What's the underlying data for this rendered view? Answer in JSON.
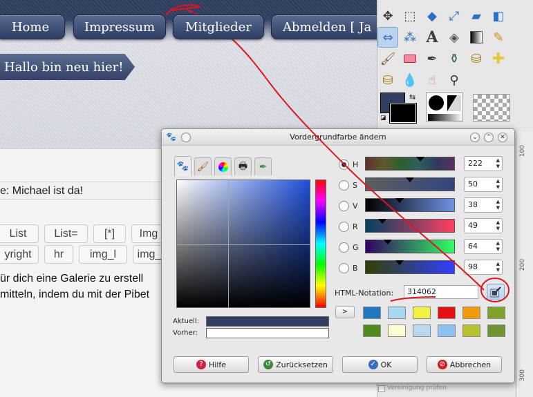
{
  "website": {
    "nav": {
      "home": "Home",
      "impressum": "Impressum",
      "mitglieder": "Mitglieder",
      "abmelden": "Abmelden [ Ja"
    },
    "post_title": "Hallo bin neu hier!",
    "reply_subject": "e: Michael ist da!",
    "bbcode_row1": [
      "List",
      "List=",
      "[*]",
      "Img"
    ],
    "bbcode_row2": [
      "yright",
      "hr",
      "img_l",
      "img_"
    ],
    "text_line1": "ür dich eine Galerie zu erstell",
    "text_line2": "mitteln, indem du mit der Pibet"
  },
  "toolbox": {
    "ruler_numbers": [
      "100",
      "200",
      "300"
    ],
    "vereinigung": "Vereinigung prüfen",
    "fg_color": "#314062"
  },
  "dialog": {
    "title": "Vordergrundfarbe ändern",
    "channels": [
      {
        "key": "H",
        "value": "222",
        "position": 0.62,
        "selected": true
      },
      {
        "key": "S",
        "value": "50",
        "position": 0.5,
        "selected": false
      },
      {
        "key": "V",
        "value": "38",
        "position": 0.38,
        "selected": false
      },
      {
        "key": "R",
        "value": "49",
        "position": 0.19,
        "selected": false
      },
      {
        "key": "G",
        "value": "64",
        "position": 0.25,
        "selected": false
      },
      {
        "key": "B",
        "value": "98",
        "position": 0.38,
        "selected": false
      }
    ],
    "compare": {
      "current_label": "Aktuell:",
      "previous_label": "Vorher:"
    },
    "html_notation_label": "HTML-Notation:",
    "html_notation_value": "314062",
    "history_arrow": ">",
    "history_colors": [
      "#1f78c0",
      "#a8d8ee",
      "#f4f040",
      "#e61010",
      "#f39a0a",
      "#7ea22a",
      "#4f8a1e",
      "#fdfdd2",
      "#bcd8f0",
      "#8cc0ef",
      "#b8c030",
      "#6e9430"
    ],
    "buttons": {
      "help": "Hilfe",
      "reset": "Zurücksetzen",
      "ok": "OK",
      "cancel": "Abbrechen"
    }
  }
}
